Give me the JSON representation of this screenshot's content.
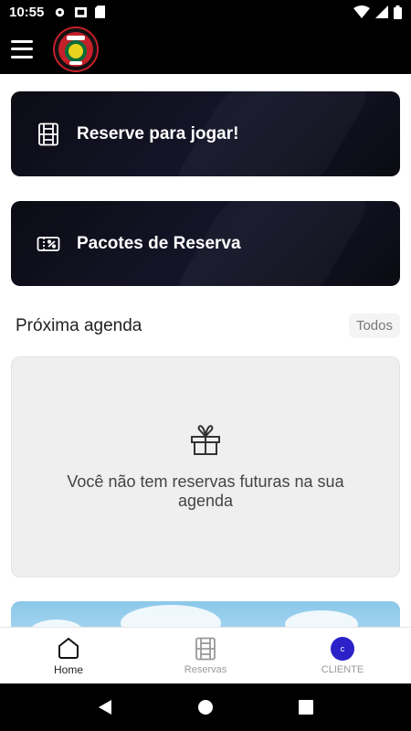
{
  "status_bar": {
    "time": "10:55"
  },
  "home": {
    "reserve_label": "Reserve para jogar!",
    "packs_label": "Pacotes de Reserva",
    "section_title": "Próxima agenda",
    "all_label": "Todos",
    "empty_message": "Você não tem reservas futuras na sua agenda"
  },
  "bottom_nav": {
    "items": [
      {
        "label": "Home",
        "icon": "home-icon",
        "active": true
      },
      {
        "label": "Reservas",
        "icon": "court-icon",
        "active": false
      },
      {
        "label": "CLIENTE",
        "icon": "avatar",
        "active": false
      }
    ],
    "avatar_initial": "c",
    "avatar_color": "#2b21c9"
  }
}
